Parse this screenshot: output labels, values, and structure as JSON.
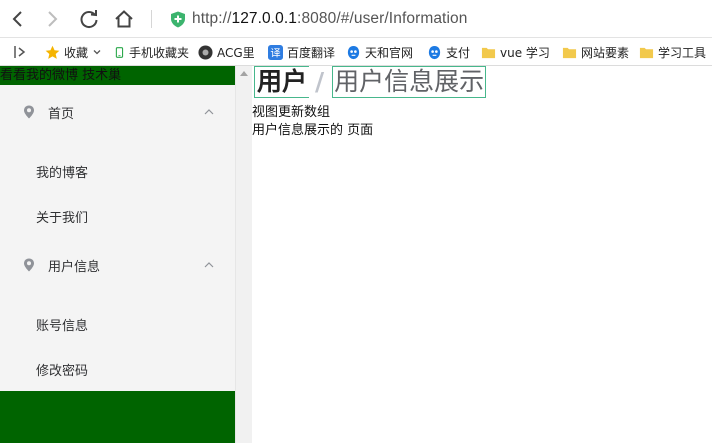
{
  "browser": {
    "url_scheme": "http://",
    "url_host": "127.0.0.1",
    "url_rest": ":8080/#/user/Information"
  },
  "bookmarks": [
    {
      "label": "收藏",
      "icon": "star-icon"
    },
    {
      "label": "手机收藏夹",
      "icon": "phone-icon"
    },
    {
      "label": "ACG里",
      "icon": "acg-icon"
    },
    {
      "label": "百度翻译",
      "icon": "translate-icon"
    },
    {
      "label": "天和官网",
      "icon": "bird-icon"
    },
    {
      "label": "支付",
      "icon": "bird-icon"
    },
    {
      "label": "vue 学习",
      "icon": "folder-icon"
    },
    {
      "label": "网站要素",
      "icon": "folder-icon"
    },
    {
      "label": "学习工具",
      "icon": "folder-icon"
    }
  ],
  "sidebar": {
    "header_text": "看看我的微博 技术巢",
    "groups": [
      {
        "label": "首页",
        "items": [
          "我的博客",
          "关于我们"
        ]
      },
      {
        "label": "用户信息",
        "items": [
          "账号信息",
          "修改密码"
        ]
      }
    ]
  },
  "main": {
    "breadcrumb": {
      "first": "用户",
      "separator": "/",
      "current": "用户信息展示"
    },
    "line1": "视图更新数组",
    "line2": "用户信息展示的 页面"
  },
  "colors": {
    "sidebar_band": "#006400",
    "accent_outline": "#47b78c"
  }
}
